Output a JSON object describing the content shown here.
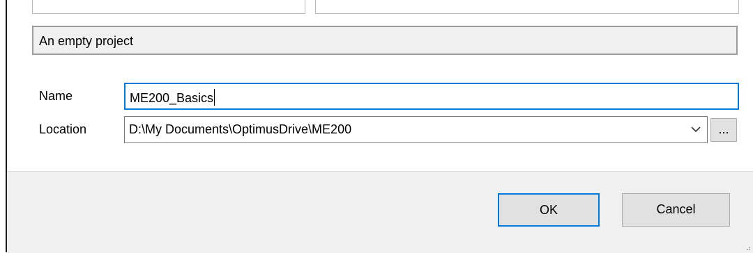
{
  "description": "An empty project",
  "form": {
    "name_label": "Name",
    "name_value": "ME200_Basics",
    "location_label": "Location",
    "location_value": "D:\\My Documents\\OptimusDrive\\ME200",
    "browse_label": "..."
  },
  "buttons": {
    "ok_label": "OK",
    "cancel_label": "Cancel"
  },
  "icons": {
    "combo_arrow": "chevron-down-icon",
    "resize_grip": "resize-grip-icon"
  },
  "colors": {
    "focus_border": "#0078d7",
    "button_bar": "#f0f0f0",
    "button_face": "#e1e1e1"
  }
}
